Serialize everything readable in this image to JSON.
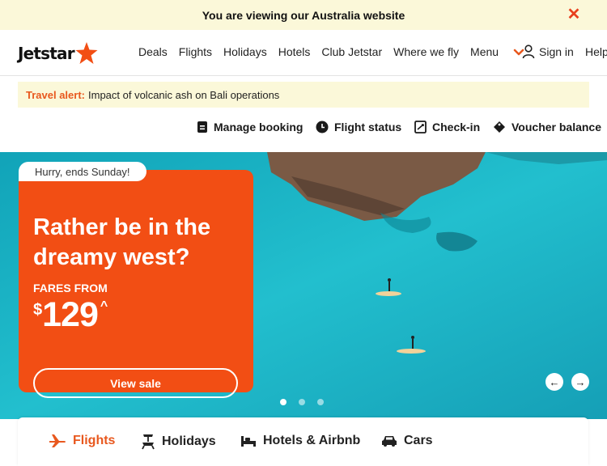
{
  "region_banner": {
    "message": "You are viewing our Australia website",
    "close_glyph": "✕"
  },
  "header": {
    "logo_text": "Jetstar",
    "nav": [
      "Deals",
      "Flights",
      "Holidays",
      "Hotels",
      "Club Jetstar",
      "Where we fly",
      "Menu"
    ],
    "sign_in": "Sign in",
    "help": "Help"
  },
  "alert": {
    "label": "Travel alert:",
    "text": "Impact of volcanic ash on Bali operations"
  },
  "quick_links": [
    "Manage booking",
    "Flight status",
    "Check-in",
    "Voucher balance"
  ],
  "hero": {
    "badge": "Hurry, ends Sunday!",
    "headline": "Rather be in the dreamy west?",
    "fares_from": "FARES FROM",
    "currency": "$",
    "price": "129",
    "price_note": "^",
    "cta": "View sale",
    "prev_glyph": "←",
    "next_glyph": "→",
    "slide_count": 3,
    "active_slide": 1
  },
  "tabs": [
    "Flights",
    "Holidays",
    "Hotels & Airbnb",
    "Cars"
  ],
  "active_tab": "Flights",
  "colors": {
    "brand": "#f24e14",
    "accent_text": "#e8581e",
    "banner_bg": "#fbf8d9",
    "sea": "#1ab5c7"
  },
  "icons": {
    "close": "close-icon",
    "menu": "chevron-down-icon",
    "sign_in": "user-icon",
    "manage_booking": "document-icon",
    "flight_status": "clock-icon",
    "check_in": "boarding-pass-icon",
    "voucher": "tag-icon",
    "flights_tab": "plane-icon",
    "holidays_tab": "beach-chair-icon",
    "hotels_tab": "bed-icon",
    "cars_tab": "car-icon"
  }
}
